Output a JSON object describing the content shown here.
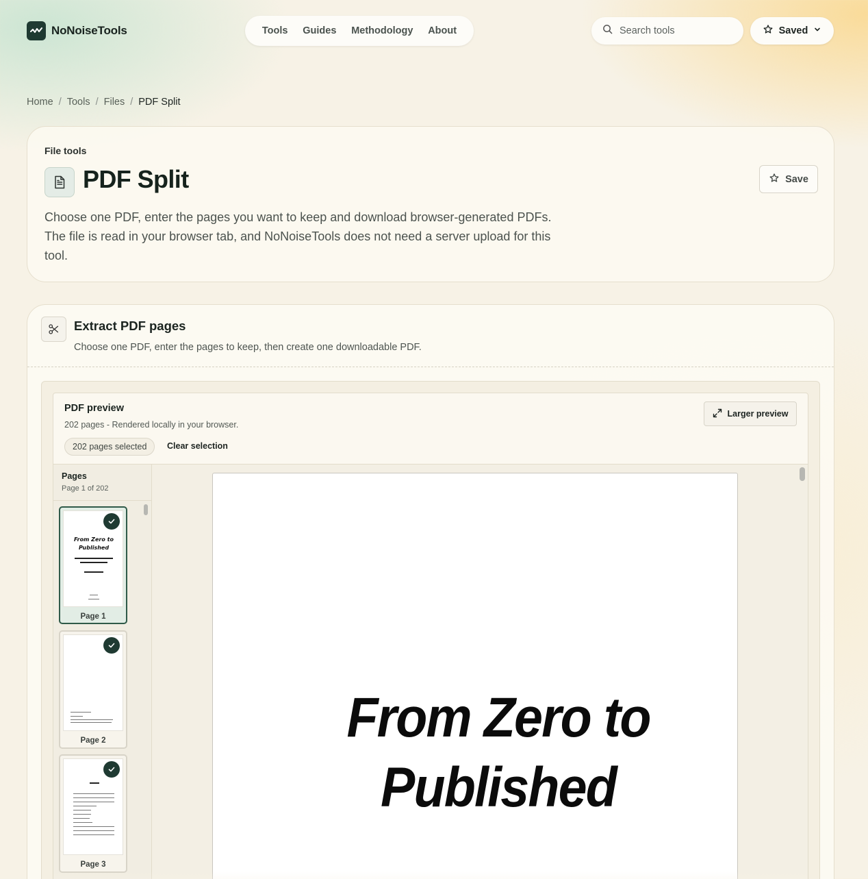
{
  "header": {
    "brand": "NoNoiseTools",
    "nav": [
      "Tools",
      "Guides",
      "Methodology",
      "About"
    ],
    "search_placeholder": "Search tools",
    "saved_label": "Saved"
  },
  "breadcrumb": [
    "Home",
    "Tools",
    "Files",
    "PDF Split"
  ],
  "hero": {
    "eyebrow": "File tools",
    "title": "PDF Split",
    "save_label": "Save",
    "description": "Choose one PDF, enter the pages you want to keep and download browser-generated PDFs. The file is read in your browser tab, and NoNoiseTools does not need a server upload for this tool."
  },
  "tool": {
    "title": "Extract PDF pages",
    "subtitle": "Choose one PDF, enter the pages to keep, then create one downloadable PDF."
  },
  "preview": {
    "title": "PDF preview",
    "meta": "202 pages - Rendered locally in your browser.",
    "selected_pill": "202 pages selected",
    "clear_label": "Clear selection",
    "larger_label": "Larger preview",
    "pages_title": "Pages",
    "pages_meta": "Page 1 of 202",
    "thumbnails": [
      {
        "label": "Page 1",
        "selected": true
      },
      {
        "label": "Page 2",
        "selected": true
      },
      {
        "label": "Page 3",
        "selected": true
      }
    ],
    "page_title_line1": "From Zero to",
    "page_title_line2": "Published"
  },
  "colors": {
    "brand": "#1f3a32",
    "accent_bg": "#f7f2e6"
  }
}
